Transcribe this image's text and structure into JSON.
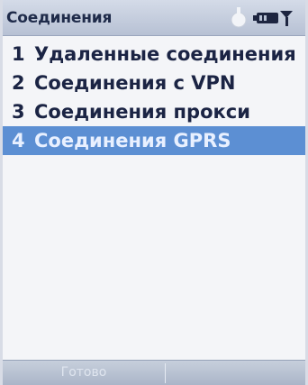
{
  "window": {
    "title": "Соединения"
  },
  "status_icons": [
    "sync-icon",
    "battery-icon",
    "signal-icon"
  ],
  "menu": {
    "items": [
      {
        "number": "1",
        "label": "Удаленные соединения",
        "selected": false
      },
      {
        "number": "2",
        "label": "Соединения с VPN",
        "selected": false
      },
      {
        "number": "3",
        "label": "Соединения прокси",
        "selected": false
      },
      {
        "number": "4",
        "label": "Соединения GPRS",
        "selected": true
      }
    ]
  },
  "softkeys": {
    "left_label": "Готово",
    "right_label": ""
  },
  "colors": {
    "selection": "#5c8fd3",
    "titlebar": "#b7c1d4",
    "text": "#1b2444"
  }
}
